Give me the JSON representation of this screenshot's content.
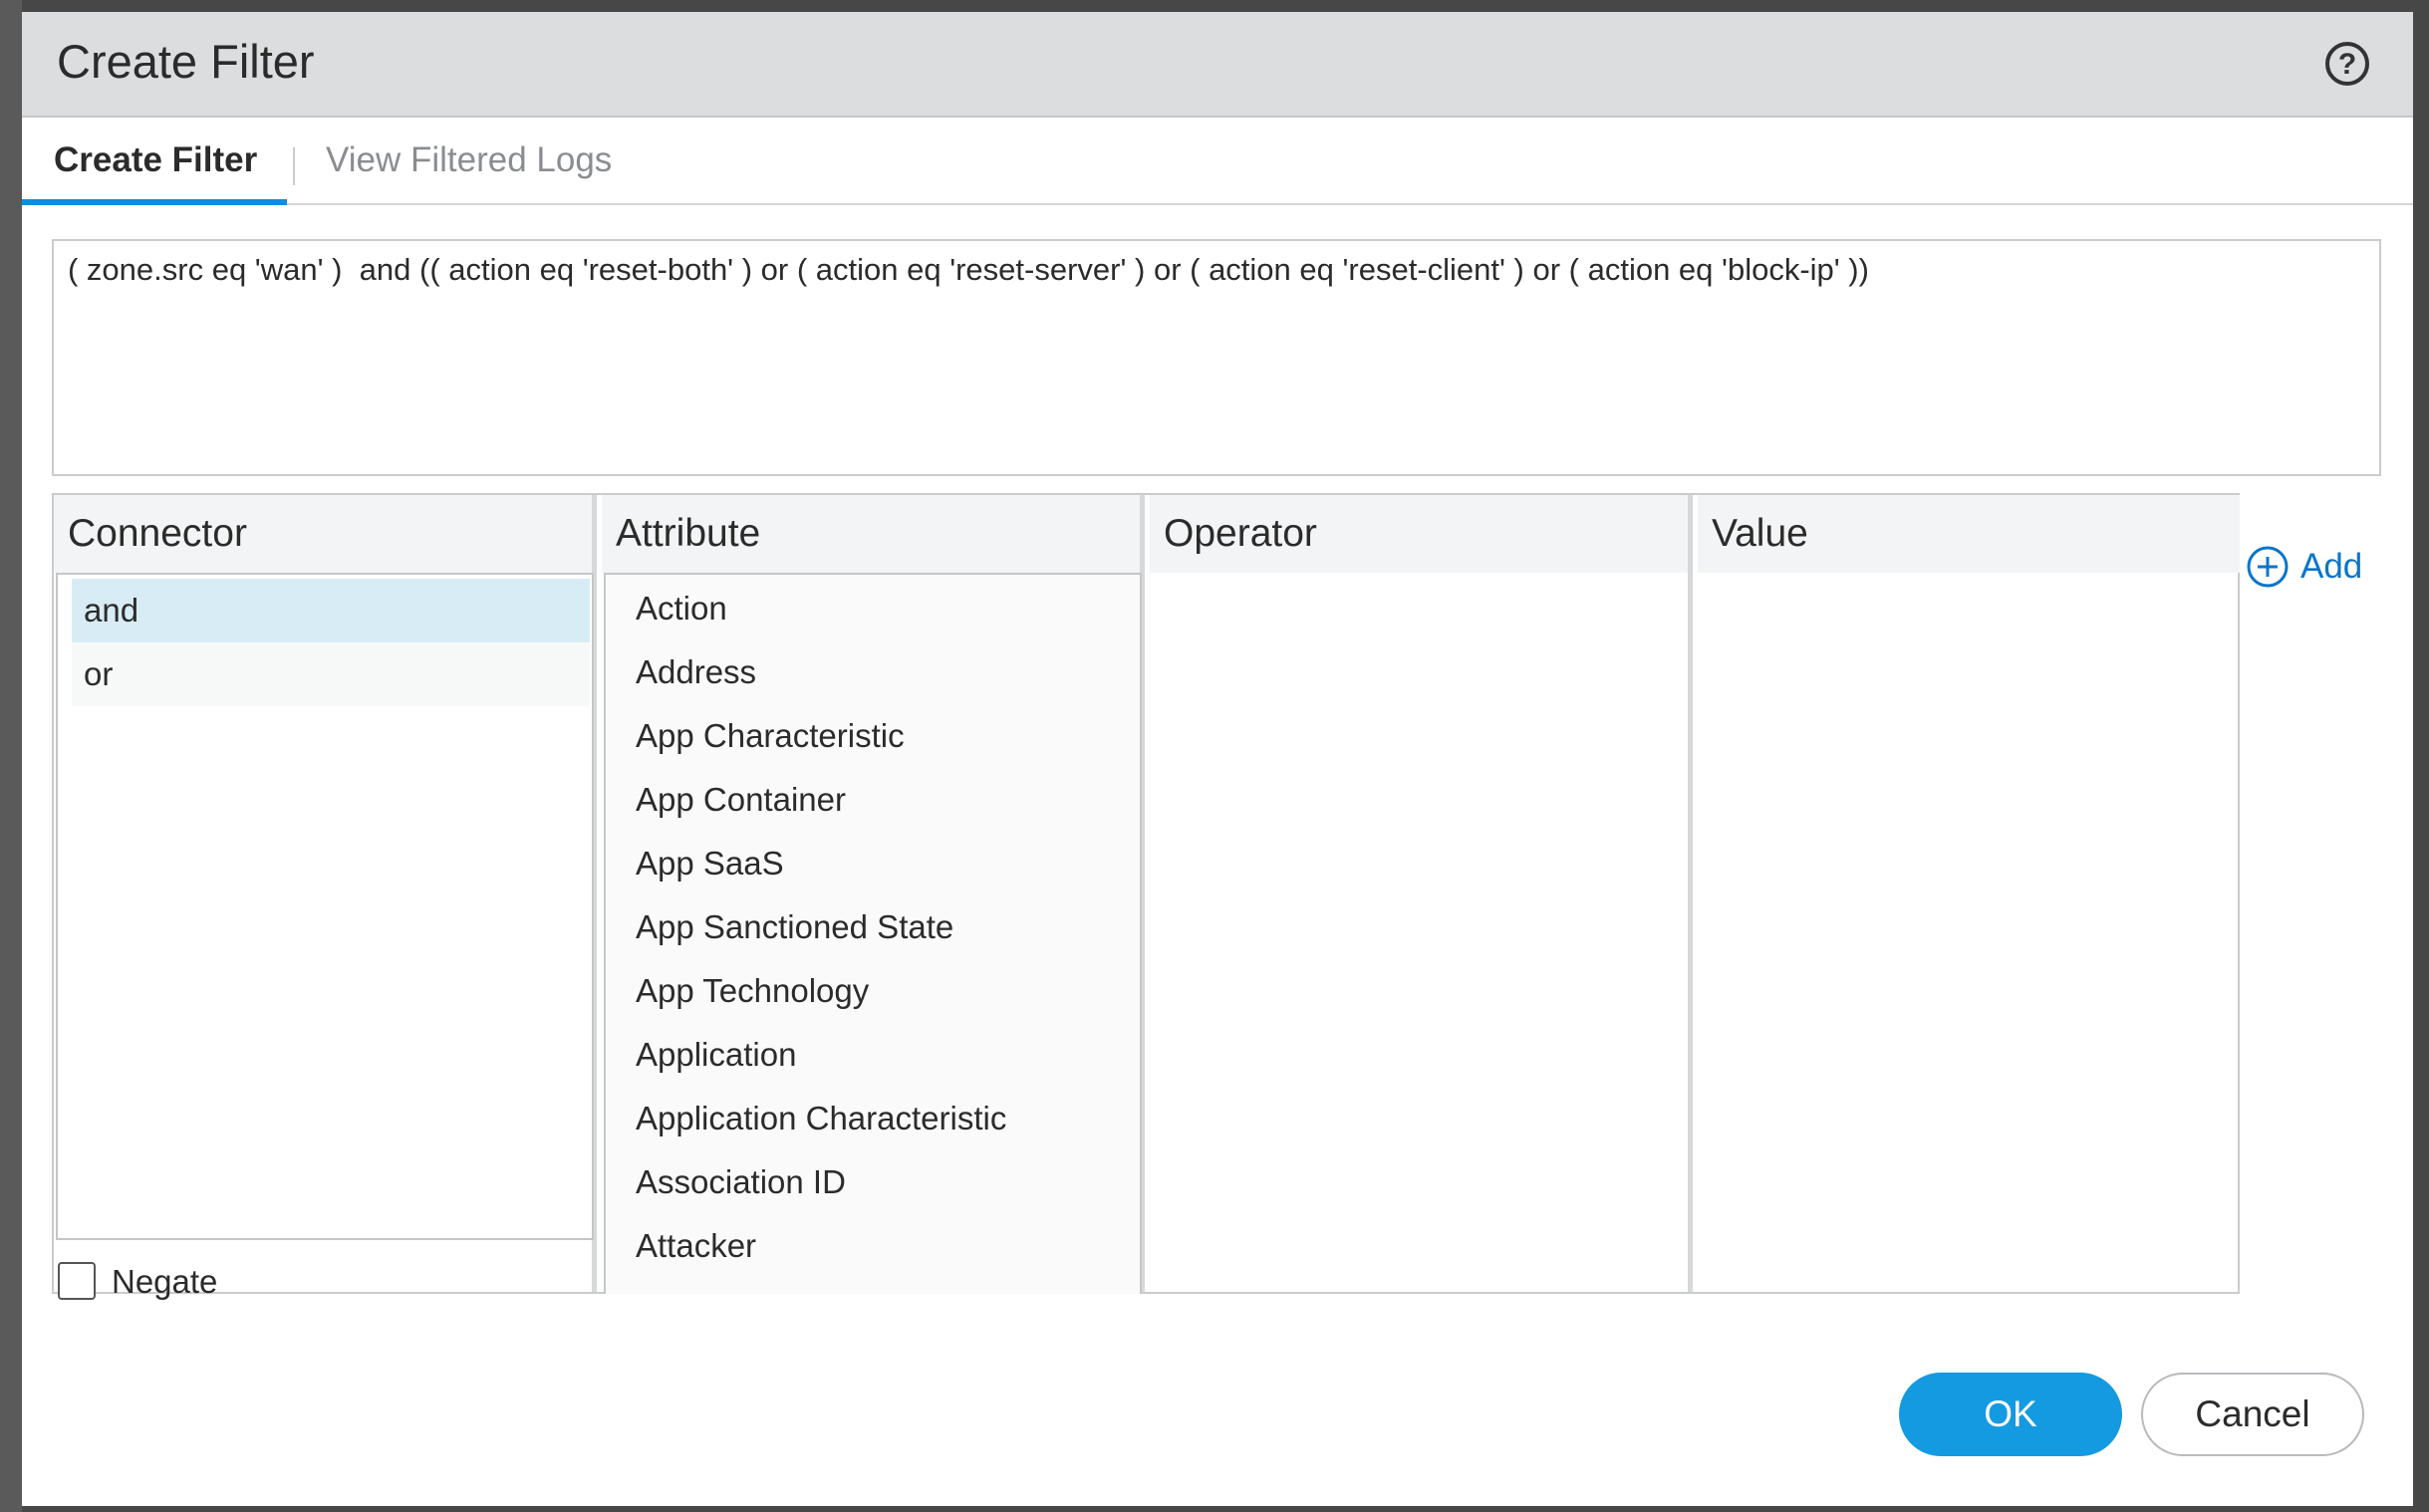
{
  "dialog": {
    "title": "Create Filter",
    "help_icon": "question-circle-icon"
  },
  "tabs": [
    {
      "label": "Create Filter",
      "active": true
    },
    {
      "label": "View Filtered Logs",
      "active": false
    }
  ],
  "filter_expression": "( zone.src eq 'wan' )  and (( action eq 'reset-both' ) or ( action eq 'reset-server' ) or ( action eq 'reset-client' ) or ( action eq 'block-ip' ))",
  "columns": {
    "connector": "Connector",
    "attribute": "Attribute",
    "operator": "Operator",
    "value": "Value"
  },
  "connector_options": [
    {
      "label": "and",
      "selected": true
    },
    {
      "label": "or",
      "selected": false
    }
  ],
  "attribute_options": [
    "Action",
    "Address",
    "App Characteristic",
    "App Container",
    "App SaaS",
    "App Sanctioned State",
    "App Technology",
    "Application",
    "Application Characteristic",
    "Association ID",
    "Attacker"
  ],
  "negate": {
    "label": "Negate",
    "checked": false
  },
  "add": {
    "label": "Add",
    "icon": "plus-circle-icon"
  },
  "buttons": {
    "ok": "OK",
    "cancel": "Cancel"
  },
  "colors": {
    "accent": "#149ae0",
    "link": "#0b75c9",
    "selected_row": "#d8ecf6",
    "titlebar": "#dcdddf"
  }
}
